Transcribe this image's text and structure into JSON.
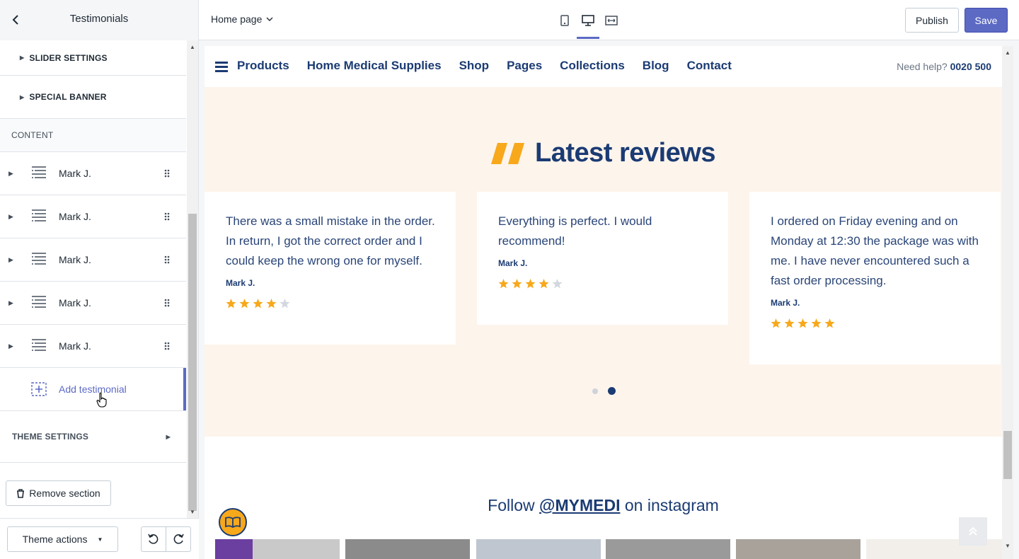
{
  "header": {
    "sidebar_title": "Testimonials",
    "page_selector": "Home page",
    "viewports": [
      "mobile-icon",
      "desktop-icon",
      "fullwidth-icon"
    ],
    "publish_label": "Publish",
    "save_label": "Save"
  },
  "sidebar": {
    "collapsed_sections": [
      "SLIDER SETTINGS",
      "SPECIAL BANNER"
    ],
    "content_header": "CONTENT",
    "blocks": [
      "Mark J.",
      "Mark J.",
      "Mark J.",
      "Mark J.",
      "Mark J."
    ],
    "add_block_label": "Add testimonial",
    "theme_settings_label": "THEME SETTINGS",
    "remove_section_label": "Remove section",
    "theme_actions_label": "Theme actions"
  },
  "preview": {
    "nav": {
      "items": [
        "Products",
        "Home Medical Supplies",
        "Shop",
        "Pages",
        "Collections",
        "Blog",
        "Contact"
      ],
      "help_prefix": "Need help?",
      "help_phone": "0020 500"
    },
    "reviews": {
      "title": "Latest reviews",
      "cards": [
        {
          "text": "There was a small mistake in the order. In return, I got the correct order and I could keep the wrong one for myself.",
          "author": "Mark J.",
          "rating": 4
        },
        {
          "text": "Everything is perfect. I would recommend!",
          "author": "Mark J.",
          "rating": 4
        },
        {
          "text": " I ordered on Friday evening and on Monday at 12:30 the package was with me. I have never encountered such a fast order processing.",
          "author": "Mark J.",
          "rating": 5
        }
      ],
      "active_dot": 2
    },
    "instagram": {
      "prefix": "Follow",
      "handle": "@MYMEDI",
      "suffix": "on instagram"
    }
  },
  "colors": {
    "accent": "#5c6ac4",
    "navy": "#1b3b73",
    "star": "#f7a81b",
    "star_empty": "#d3d7de",
    "reviews_bg": "#fdf4ec"
  }
}
